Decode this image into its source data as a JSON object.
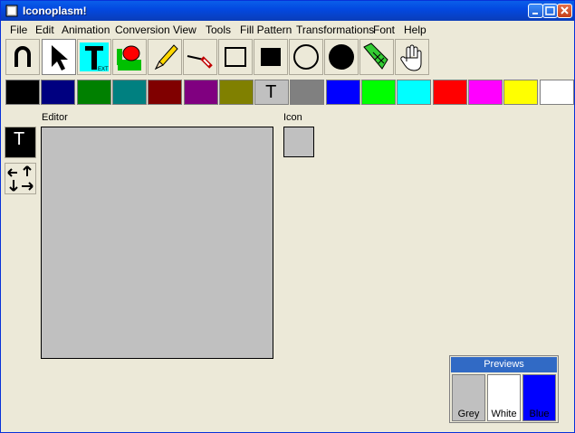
{
  "window": {
    "title": "Iconoplasm!"
  },
  "menu": [
    "File",
    "Edit",
    "Animation",
    "Conversion",
    "View",
    "Tools",
    "Fill Pattern",
    "Transformations",
    "Font",
    "Help"
  ],
  "tools": [
    {
      "name": "undo-icon"
    },
    {
      "name": "pointer-icon"
    },
    {
      "name": "text-icon"
    },
    {
      "name": "paint-bucket-icon"
    },
    {
      "name": "pencil-icon"
    },
    {
      "name": "eyedropper-icon"
    },
    {
      "name": "rectangle-outline-icon"
    },
    {
      "name": "rectangle-filled-icon"
    },
    {
      "name": "circle-outline-icon"
    },
    {
      "name": "circle-filled-icon"
    },
    {
      "name": "spray-icon"
    },
    {
      "name": "hand-icon"
    }
  ],
  "palette": [
    "#000000",
    "#000080",
    "#008000",
    "#008080",
    "#800000",
    "#800080",
    "#808000",
    "#C0C0C0",
    "#808080",
    "#0000FF",
    "#00FF00",
    "#00FFFF",
    "#FF0000",
    "#FF00FF",
    "#FFFF00",
    "#FFFFFF"
  ],
  "palette_transparent_label": "T",
  "labels": {
    "editor": "Editor",
    "icon": "Icon"
  },
  "side": {
    "transparent_label": "T"
  },
  "previews": {
    "title": "Previews",
    "items": [
      {
        "label": "Grey",
        "color": "#C0C0C0"
      },
      {
        "label": "White",
        "color": "#FFFFFF"
      },
      {
        "label": "Blue",
        "color": "#0000FF"
      }
    ]
  }
}
